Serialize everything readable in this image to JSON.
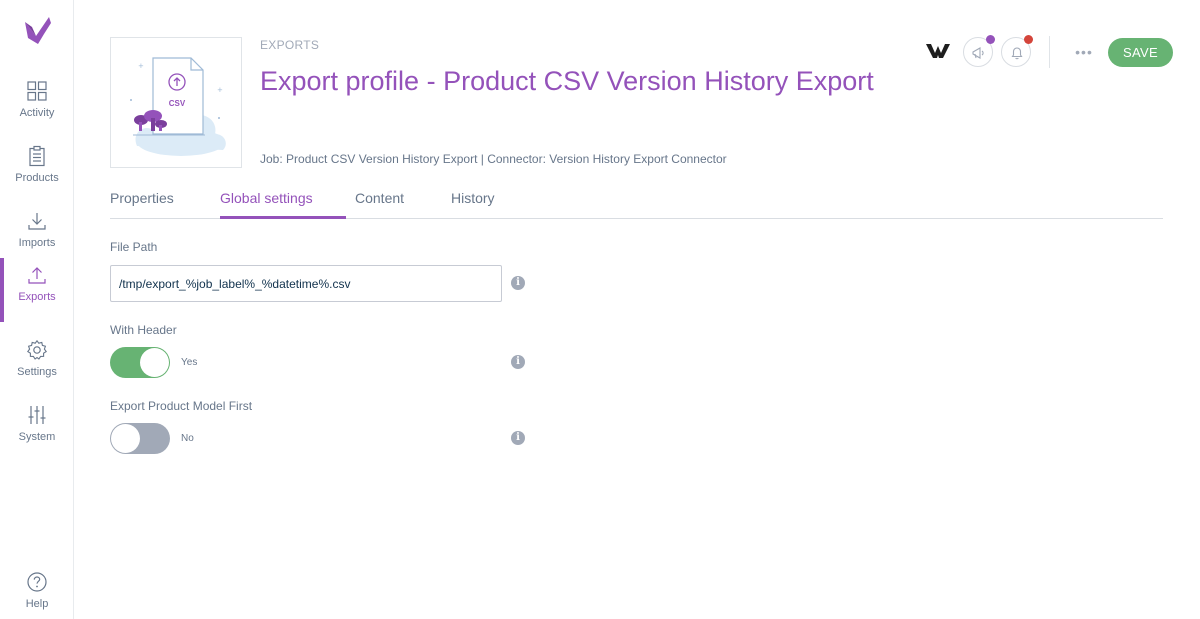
{
  "sidebar": {
    "items": [
      {
        "label": "Activity"
      },
      {
        "label": "Products"
      },
      {
        "label": "Imports"
      },
      {
        "label": "Exports"
      },
      {
        "label": "Settings"
      },
      {
        "label": "System"
      }
    ],
    "help_label": "Help",
    "active_item": "Exports"
  },
  "header": {
    "breadcrumb": "EXPORTS",
    "title": "Export profile - Product CSV Version History Export",
    "meta": "Job: Product CSV Version History Export | Connector: Version History Export Connector",
    "thumbnail_text": "CSV",
    "save_label": "SAVE",
    "more_label": "•••",
    "notification_dot_color": "#d4453b",
    "announcement_dot_color": "#9452ba"
  },
  "tabs": [
    {
      "label": "Properties",
      "active": false
    },
    {
      "label": "Global settings",
      "active": true
    },
    {
      "label": "Content",
      "active": false
    },
    {
      "label": "History",
      "active": false
    }
  ],
  "form": {
    "file_path": {
      "label": "File Path",
      "value": "/tmp/export_%job_label%_%datetime%.csv"
    },
    "with_header": {
      "label": "With Header",
      "checked": true,
      "state_text": "Yes"
    },
    "export_product_model_first": {
      "label": "Export Product Model First",
      "checked": false,
      "state_text": "No"
    }
  },
  "colors": {
    "accent": "#9452ba",
    "success": "#67b373",
    "muted": "#a1a9b7",
    "text": "#67768a"
  },
  "icons": {
    "info": "i"
  }
}
